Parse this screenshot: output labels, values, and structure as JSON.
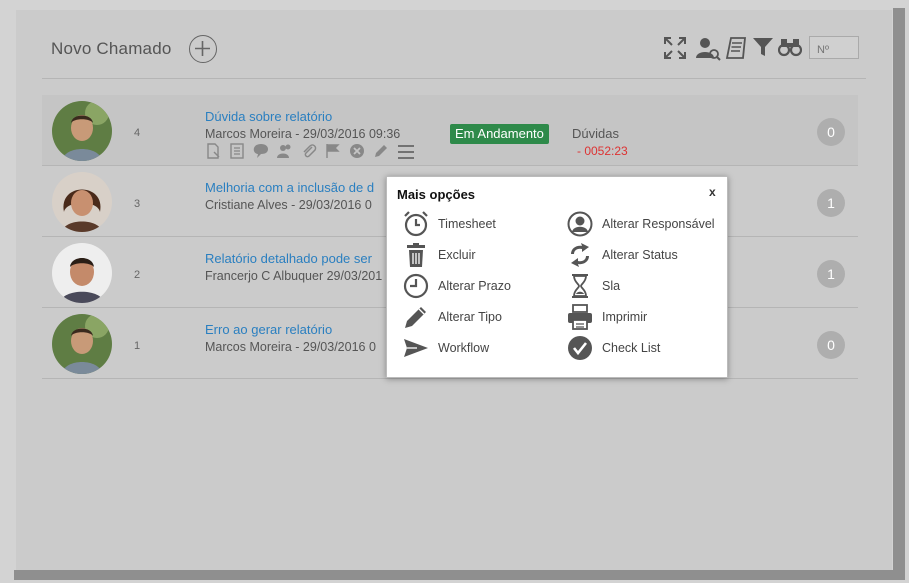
{
  "header": {
    "title": "Novo Chamado",
    "search_placeholder": "Nº"
  },
  "colors": {
    "link": "#2a7fc0",
    "status_green": "#2e8a4a",
    "sla_red": "#dd3333",
    "count_badge": "#aeaeae"
  },
  "tickets": [
    {
      "number": "4",
      "title": "Dúvida sobre relatório",
      "subtitle": "Marcos Moreira - 29/03/2016 09:36",
      "count": "0",
      "status": "Em Andamento",
      "category": "Dúvidas",
      "sla": "- 0052:23"
    },
    {
      "number": "3",
      "title": "Melhoria com a inclusão de d",
      "subtitle": "Cristiane Alves - 29/03/2016 0",
      "count": "1"
    },
    {
      "number": "2",
      "title": "Relatório detalhado pode ser",
      "subtitle": "Francerjo C Albuquer 29/03/201",
      "count": "1"
    },
    {
      "number": "1",
      "title": "Erro ao gerar relatório",
      "subtitle": "Marcos Moreira - 29/03/2016 0",
      "count": "0"
    }
  ],
  "row_actions": [
    "new-doc-icon",
    "list-icon",
    "comment-icon",
    "users-icon",
    "attach-icon",
    "flag-icon",
    "cancel-icon",
    "edit-icon",
    "menu-icon"
  ],
  "popup": {
    "title": "Mais opções",
    "close": "x",
    "left_options": [
      {
        "label": "Timesheet",
        "icon": "alarm-clock-icon"
      },
      {
        "label": "Excluir",
        "icon": "trash-icon"
      },
      {
        "label": "Alterar Prazo",
        "icon": "clock-icon"
      },
      {
        "label": "Alterar Tipo",
        "icon": "pencil-icon"
      },
      {
        "label": "Workflow",
        "icon": "send-icon"
      }
    ],
    "right_options": [
      {
        "label": "Alterar Responsável",
        "icon": "user-circle-icon"
      },
      {
        "label": "Alterar Status",
        "icon": "refresh-icon"
      },
      {
        "label": "Sla",
        "icon": "hourglass-icon"
      },
      {
        "label": "Imprimir",
        "icon": "printer-icon"
      },
      {
        "label": "Check List",
        "icon": "check-circle-icon"
      }
    ]
  }
}
